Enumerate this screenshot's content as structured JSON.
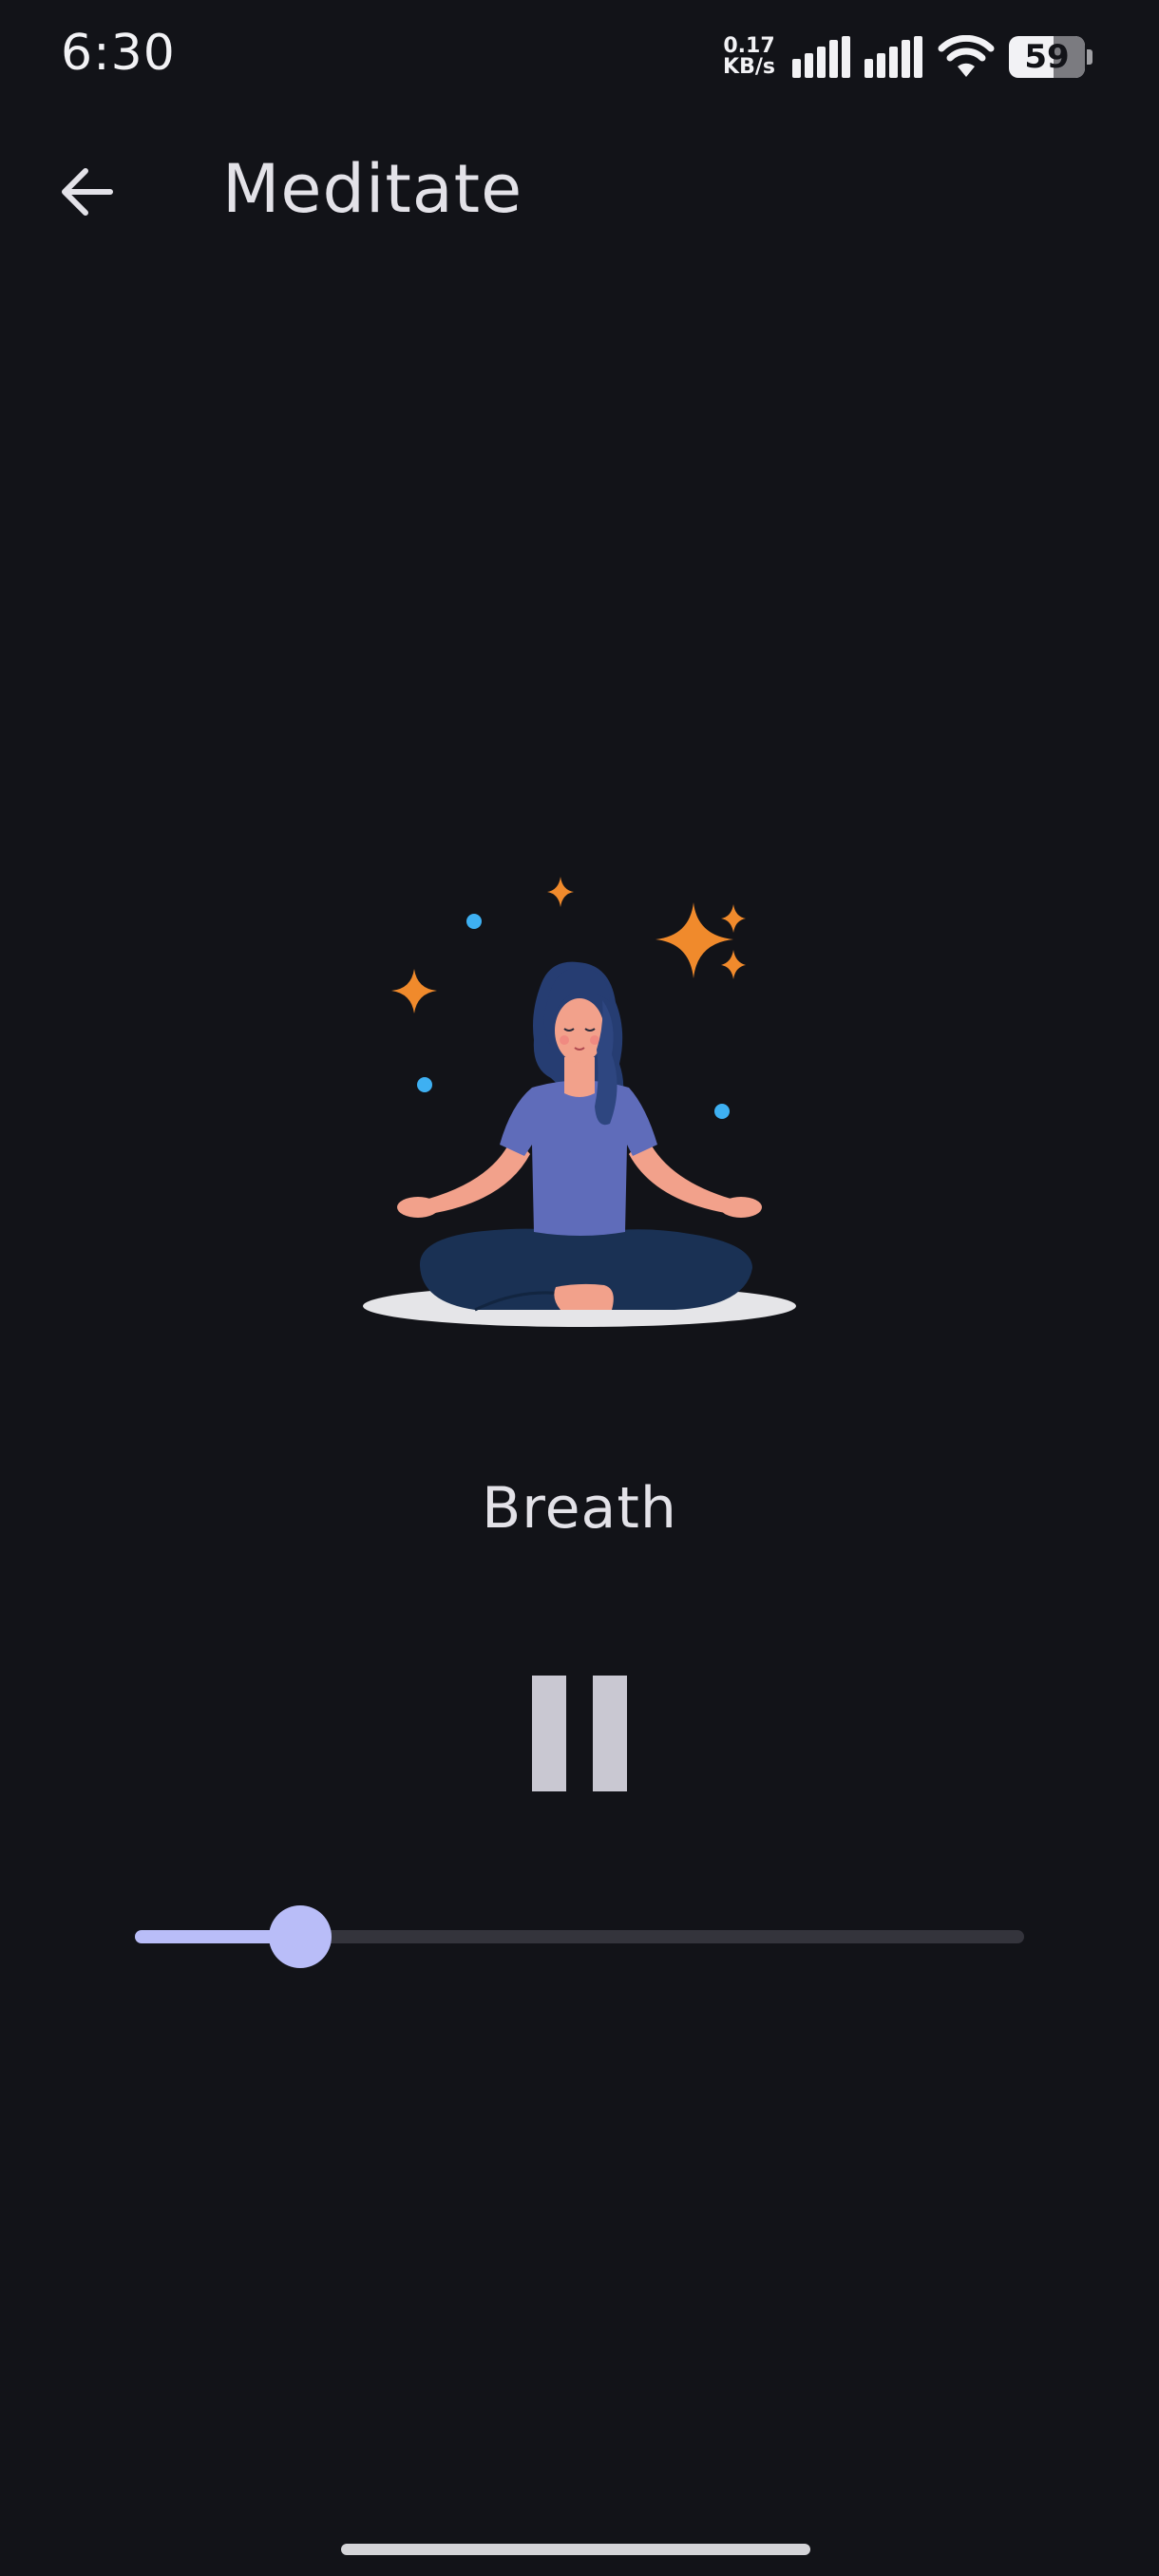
{
  "status_bar": {
    "time": "6:30",
    "net_speed_value": "0.17",
    "net_speed_unit": "KB/s",
    "battery_level": "59",
    "battery_fraction": 0.59,
    "icons": [
      "signal-icon",
      "signal-icon",
      "wifi-icon",
      "battery-icon"
    ]
  },
  "app_bar": {
    "back_icon": "arrow-left-icon",
    "title": "Meditate"
  },
  "player": {
    "illustration": "meditating-woman-illustration",
    "track_title": "Breath",
    "control_icon": "pause-icon",
    "progress_fraction": 0.186
  },
  "colors": {
    "background": "#121318",
    "accent": "#b9bdf8",
    "text": "#e3e2e8",
    "pause": "#c9c8d2",
    "sparkle": "#f08a2c",
    "dot": "#3eb0f2"
  }
}
